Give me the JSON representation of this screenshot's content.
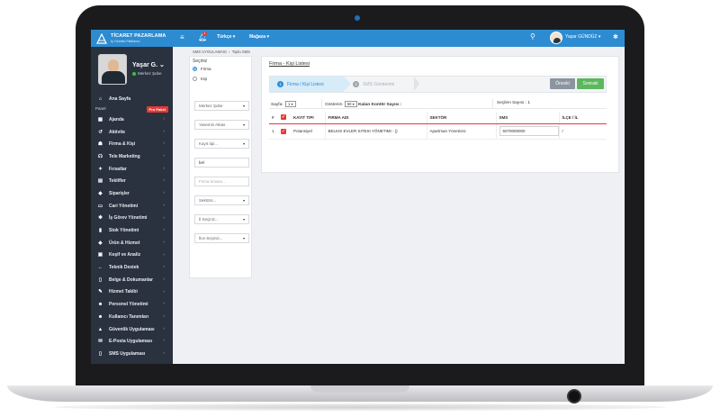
{
  "topbar": {
    "brand_title": "TİCARET PAZARLAMA",
    "brand_subtitle": "İş Yönetim Platformu",
    "menu_icon": "hamburger-icon",
    "bell_badge": "1",
    "language": "Türkçe ▾",
    "store": "Mağaza ▾",
    "user_name": "Yaşar GÜNDÜZ ▾"
  },
  "sidebar": {
    "profile_name": "Yaşar G. ⌄",
    "profile_branch": "Merkez Şube",
    "home": "Ana Sayfa",
    "panel_label": "Panel",
    "pro_badge": "Pro Paket",
    "items": [
      {
        "label": "Ajanda",
        "icon": "calendar-icon"
      },
      {
        "label": "Aktivite",
        "icon": "history-icon"
      },
      {
        "label": "Firma & Kişi",
        "icon": "person-icon"
      },
      {
        "label": "Tele Marketing",
        "icon": "headset-icon"
      },
      {
        "label": "Fırsatlar",
        "icon": "magic-icon"
      },
      {
        "label": "Teklifler",
        "icon": "document-icon"
      },
      {
        "label": "Siparişler",
        "icon": "tag-icon"
      },
      {
        "label": "Cari Yönetimi",
        "icon": "card-icon"
      },
      {
        "label": "İş Görev Yönetimi",
        "icon": "gear-icon"
      },
      {
        "label": "Stok Yönetimi",
        "icon": "signal-icon"
      },
      {
        "label": "Ürün & Hizmet",
        "icon": "tags-icon"
      },
      {
        "label": "Keşif ve Analiz",
        "icon": "car-icon"
      },
      {
        "label": "Teknik Destek",
        "icon": "arrow-left-icon"
      },
      {
        "label": "Belge & Dokumanlar",
        "icon": "file-icon"
      },
      {
        "label": "Hizmet Takibi",
        "icon": "pencil-icon"
      },
      {
        "label": "Personel Yönetimi",
        "icon": "users-icon"
      },
      {
        "label": "Kullanıcı Tanımları",
        "icon": "users-icon"
      },
      {
        "label": "Güvenlik Uygulaması",
        "icon": "lock-icon"
      },
      {
        "label": "E-Posta Uygulaması",
        "icon": "envelope-icon"
      },
      {
        "label": "SMS Uygulaması",
        "icon": "phone-icon"
      }
    ]
  },
  "breadcrumb": {
    "parent": "SMS UYGULAMASI",
    "separator": "›",
    "current": "Toplu SMS"
  },
  "filter": {
    "title": "Seçiniz",
    "radio_company": "Firma",
    "radio_person": "Kişi",
    "branch": "Merkez Şube",
    "user": "Yasemin Aktas",
    "record_type": "Kayıt tipi...",
    "search_value": "bel",
    "company_title_placeholder": "Firma ünvanı...",
    "sector": "Sektörü...",
    "city": "İl Seçiniz...",
    "district": "İlce Seçiniz..."
  },
  "main": {
    "title": "Firma - Kişi Listesi",
    "step1_num": "1",
    "step1_label": "Firma / Kişi Listesi",
    "step2_num": "2",
    "step2_label": "SMS Gönderimi",
    "prev_label": "Önceki",
    "next_label": "Sonraki",
    "page_label": "Sayfa:",
    "page_value": "1 ▾",
    "show_label": "Gösterim",
    "show_value": "50 ▾",
    "credit_label": "Kalan Kontör Sayısı :",
    "selected_label": "Seçilen Sayısı : 1"
  },
  "table": {
    "headers": [
      "#",
      "",
      "KAYIT TIPI",
      "FIRMA ADI",
      "SEKTÖR",
      "SMS",
      "İLÇE / İL"
    ],
    "rows": [
      {
        "index": "1",
        "record_type": "Potansiyel",
        "company": "BELKIS EVLER SITESI YÖNETIMI - ()",
        "sector": "Apartman Yöneticisi",
        "sms": "5070000000",
        "location": "/"
      }
    ]
  }
}
